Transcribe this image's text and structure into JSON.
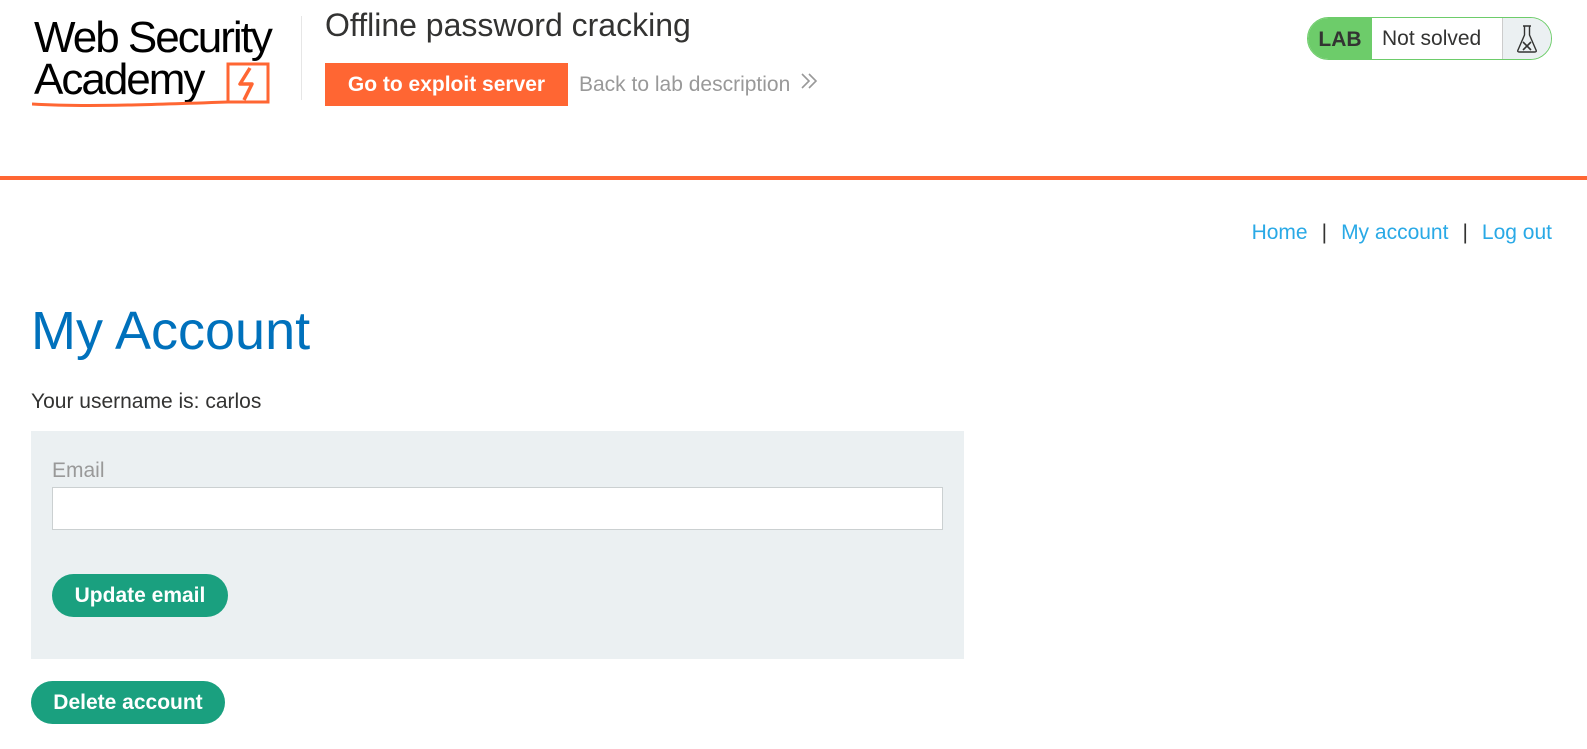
{
  "header": {
    "logo_text_line1": "Web Security",
    "logo_text_line2": "Academy",
    "lab_title": "Offline password cracking",
    "exploit_button_label": "Go to exploit server",
    "back_link_label": "Back to lab description",
    "lab_badge": "LAB",
    "lab_status": "Not solved",
    "status_icon": "flask-icon"
  },
  "nav": {
    "items": [
      {
        "label": "Home"
      },
      {
        "label": "My account"
      },
      {
        "label": "Log out"
      }
    ],
    "separator": "|"
  },
  "main": {
    "title": "My Account",
    "username_text": "Your username is: carlos",
    "email_label": "Email",
    "email_value": "",
    "update_button_label": "Update email",
    "delete_button_label": "Delete account"
  },
  "colors": {
    "accent_orange": "#ff6633",
    "link_blue": "#29a9e6",
    "title_blue": "#0071bc",
    "button_green": "#1aa07f",
    "lab_green": "#6dcc6a",
    "form_bg": "#ebf0f2"
  }
}
